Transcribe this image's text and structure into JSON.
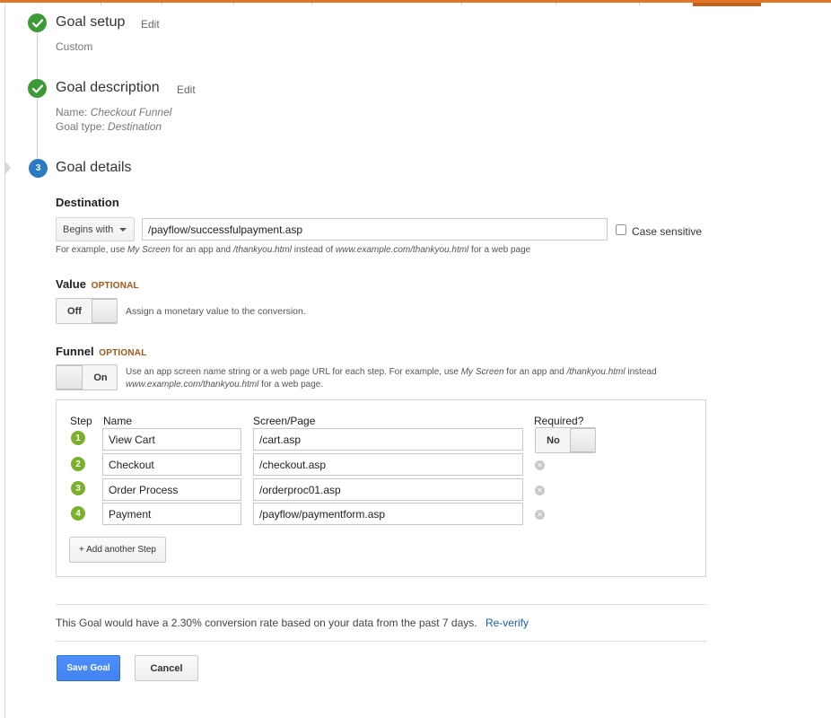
{
  "steps": {
    "setup": {
      "number": "1",
      "title": "Goal setup",
      "edit_label": "Edit",
      "detail": "Custom"
    },
    "description": {
      "number": "2",
      "title": "Goal description",
      "edit_label": "Edit",
      "name_label": "Name:",
      "name_value": "Checkout Funnel",
      "type_label": "Goal type:",
      "type_value": "Destination"
    },
    "details": {
      "number": "3",
      "title": "Goal details"
    }
  },
  "destination": {
    "label": "Destination",
    "match_type": "Begins with",
    "value": "/payflow/successfulpayment.asp",
    "case_sensitive_label": "Case sensitive",
    "case_sensitive_checked": false,
    "hint": {
      "p1": "For example, use ",
      "e1": "My Screen",
      "p2": " for an app and ",
      "e2": "/thankyou.html",
      "p3": " instead of ",
      "e3": "www.example.com/thankyou.html",
      "p4": " for a web page"
    }
  },
  "value": {
    "label": "Value",
    "optional": "OPTIONAL",
    "toggle_label": "Off",
    "toggle_on": false,
    "hint": "Assign a monetary value to the conversion."
  },
  "funnel": {
    "label": "Funnel",
    "optional": "OPTIONAL",
    "toggle_label": "On",
    "toggle_on": true,
    "hint": {
      "p1": "Use an app screen name string or a web page URL for each step. For example, use ",
      "e1": "My Screen",
      "p2": " for an app and ",
      "e2": "/thankyou.html",
      "p3": " instead",
      "e3": "www.example.com/thankyou.html",
      "p4": " for a web page."
    },
    "columns": {
      "step": "Step",
      "name": "Name",
      "screen": "Screen/Page",
      "required": "Required?"
    },
    "rows": [
      {
        "num": "1",
        "name": "View Cart",
        "screen": "/cart.asp",
        "required": "No"
      },
      {
        "num": "2",
        "name": "Checkout",
        "screen": "/checkout.asp"
      },
      {
        "num": "3",
        "name": "Order Process",
        "screen": "/orderproc01.asp"
      },
      {
        "num": "4",
        "name": "Payment",
        "screen": "/payflow/paymentform.asp"
      }
    ],
    "add_step_label": "+ Add another Step"
  },
  "verification": {
    "text": "This Goal would have a 2.30% conversion rate based on your data from the past 7 days.",
    "reverify_label": "Re-verify"
  },
  "actions": {
    "save_label": "Save Goal",
    "cancel_label": "Cancel"
  },
  "colors": {
    "accent_orange": "#e37527",
    "done_green": "#3d9b35",
    "active_blue": "#2b7bc2",
    "step_green": "#7ab02c",
    "optional_brown": "#a0571a",
    "primary_blue": "#4d90fe"
  },
  "icons": {
    "done": "check-icon",
    "remove": "remove-circle-icon",
    "caret": "chevron-down-icon"
  }
}
